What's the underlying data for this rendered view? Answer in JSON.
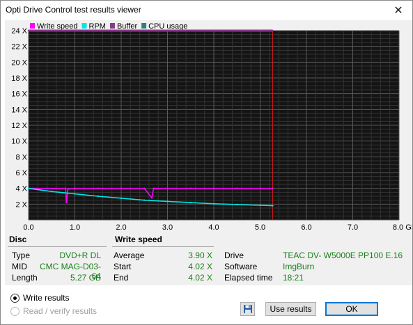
{
  "window": {
    "title": "Opti Drive Control test results viewer"
  },
  "chart_data": {
    "type": "line",
    "legend": [
      "Write speed",
      "RPM",
      "Buffer",
      "CPU usage"
    ],
    "legend_colors": [
      "#ff00ff",
      "#00e5e5",
      "#8a3a8a",
      "#2f7f7f"
    ],
    "x_ticks": [
      "0.0",
      "1.0",
      "2.0",
      "3.0",
      "4.0",
      "5.0",
      "6.0",
      "7.0",
      "8.0 GB"
    ],
    "y_ticks": [
      "24 X",
      "22 X",
      "20 X",
      "18 X",
      "16 X",
      "14 X",
      "12 X",
      "10 X",
      "8 X",
      "6 X",
      "4 X",
      "2 X"
    ],
    "xlim": [
      0,
      8
    ],
    "ylim": [
      0,
      24
    ],
    "end_marker_gb": 5.27,
    "series": [
      {
        "name": "Write speed",
        "color": "#ff00ff",
        "x": [
          0.0,
          0.1,
          0.4,
          0.8,
          0.82,
          0.85,
          1.0,
          1.5,
          2.0,
          2.5,
          2.66,
          2.7,
          3.0,
          3.5,
          4.0,
          4.5,
          5.0,
          5.27
        ],
        "y": [
          4.0,
          4.0,
          4.0,
          4.0,
          2.2,
          3.9,
          4.0,
          4.0,
          4.0,
          4.0,
          2.8,
          4.0,
          4.0,
          4.0,
          4.0,
          4.0,
          4.0,
          4.0
        ]
      },
      {
        "name": "RPM",
        "color": "#00e5e5",
        "x": [
          0.0,
          0.5,
          1.0,
          1.5,
          2.0,
          2.5,
          3.0,
          3.5,
          4.0,
          4.5,
          5.0,
          5.27
        ],
        "y": [
          4.0,
          3.6,
          3.3,
          3.0,
          2.75,
          2.5,
          2.35,
          2.2,
          2.05,
          1.95,
          1.85,
          1.8
        ]
      },
      {
        "name": "Buffer",
        "color": "#8a3a8a",
        "x": [
          0.0,
          5.27
        ],
        "y": [
          24,
          24
        ]
      }
    ]
  },
  "disc": {
    "header": "Disc",
    "rows": [
      {
        "label": "Type",
        "value": "DVD+R DL"
      },
      {
        "label": "MID",
        "value": "CMC MAG-D03-64"
      },
      {
        "label": "Length",
        "value": "5.27 GB"
      }
    ]
  },
  "write_speed": {
    "header": "Write speed",
    "rows": [
      {
        "label": "Average",
        "value": "3.90 X"
      },
      {
        "label": "Start",
        "value": "4.02 X"
      },
      {
        "label": "End",
        "value": "4.02 X"
      }
    ]
  },
  "drive_info": {
    "rows": [
      {
        "label": "Drive",
        "value": "TEAC DV- W5000E PP100 E.16"
      },
      {
        "label": "Software",
        "value": "ImgBurn"
      },
      {
        "label": "Elapsed time",
        "value": "18:21"
      }
    ]
  },
  "options": {
    "write_results": "Write results",
    "read_verify_results": "Read / verify results"
  },
  "buttons": {
    "use_results": "Use results",
    "ok": "OK"
  },
  "icons": {
    "close": "close-icon",
    "save": "floppy-disk-icon"
  }
}
